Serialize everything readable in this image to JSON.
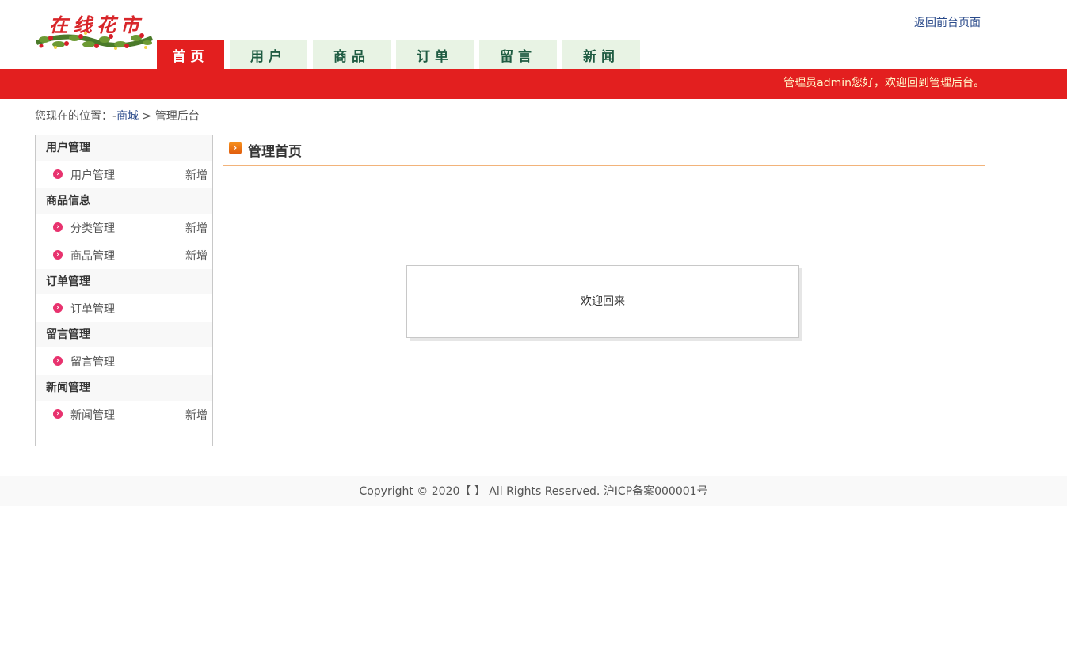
{
  "header": {
    "logo_text": "在线花市",
    "return_link": "返回前台页面",
    "tabs": [
      {
        "label": "首页"
      },
      {
        "label": "用户"
      },
      {
        "label": "商品"
      },
      {
        "label": "订单"
      },
      {
        "label": "留言"
      },
      {
        "label": "新闻"
      }
    ],
    "active_tab": "首页",
    "welcome_message": "管理员admin您好，欢迎回到管理后台。"
  },
  "breadcrumb": {
    "prefix": "您现在的位置：-",
    "link": "商城",
    "separator": ">",
    "current": "管理后台"
  },
  "sidebar": {
    "groups": [
      {
        "title": "用户管理",
        "items": [
          {
            "label": "用户管理",
            "action": "新增"
          }
        ]
      },
      {
        "title": "商品信息",
        "items": [
          {
            "label": "分类管理",
            "action": "新增"
          },
          {
            "label": "商品管理",
            "action": "新增"
          }
        ]
      },
      {
        "title": "订单管理",
        "items": [
          {
            "label": "订单管理",
            "action": ""
          }
        ]
      },
      {
        "title": "留言管理",
        "items": [
          {
            "label": "留言管理",
            "action": ""
          }
        ]
      },
      {
        "title": "新闻管理",
        "items": [
          {
            "label": "新闻管理",
            "action": "新增"
          }
        ]
      }
    ]
  },
  "main": {
    "title": "管理首页",
    "welcome_text": "欢迎回来"
  },
  "footer": {
    "text": "Copyright © 2020【 】 All Rights Reserved. 沪ICP备案000001号"
  },
  "colors": {
    "brand_red": "#e31f1f",
    "tab_bg": "#e8f3e4",
    "tab_text": "#1f5c42",
    "accent_orange": "#f2b37a",
    "link_blue": "#2b4b8b"
  }
}
